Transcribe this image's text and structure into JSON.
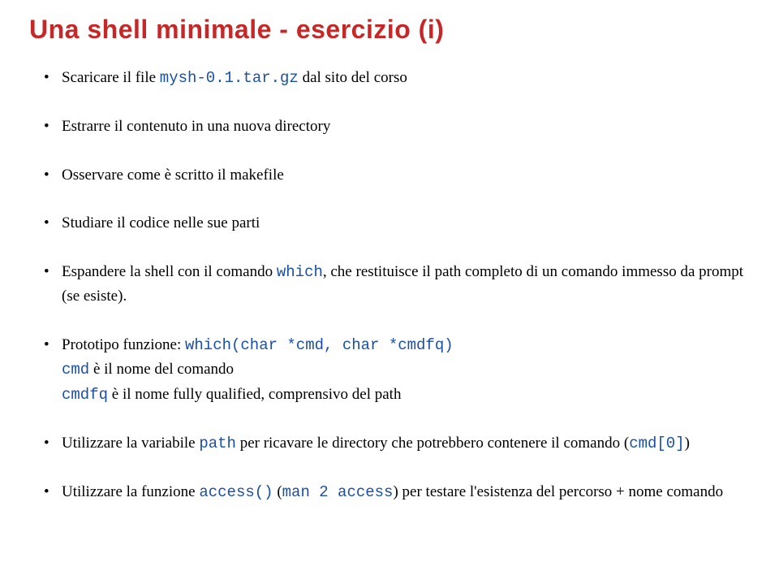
{
  "title": "Una shell minimale - esercizio (i)",
  "b1": {
    "pre": "Scaricare il file ",
    "file": "mysh-0.1.tar.gz",
    "post": " dal sito del corso"
  },
  "b2": "Estrarre il contenuto in una nuova directory",
  "b3": "Osservare come è scritto il makefile",
  "b4": "Studiare il codice nelle sue parti",
  "b5": {
    "pre": "Espandere la shell con il comando ",
    "cmd": "which",
    "post": ", che restituisce il path completo di un comando immesso da prompt (se esiste)."
  },
  "b6": {
    "line1_pre": "Prototipo funzione:   ",
    "proto": "which(char *cmd, char *cmdfq)",
    "l2a": "cmd",
    "l2b": " è il nome del comando",
    "l3a": "cmdfq",
    "l3b": " è il nome fully qualified, comprensivo del path"
  },
  "b7": {
    "pre": "Utilizzare la variabile ",
    "v": "path",
    "mid": " per ricavare le directory che potrebbero contenere il comando (",
    "c": "cmd[0]",
    "post": ")"
  },
  "b8": {
    "pre": "Utilizzare la funzione ",
    "f1": "access()",
    "mid1": " (",
    "man": "man 2 access",
    "mid2": ") per testare l'esistenza del percorso + nome comando"
  }
}
